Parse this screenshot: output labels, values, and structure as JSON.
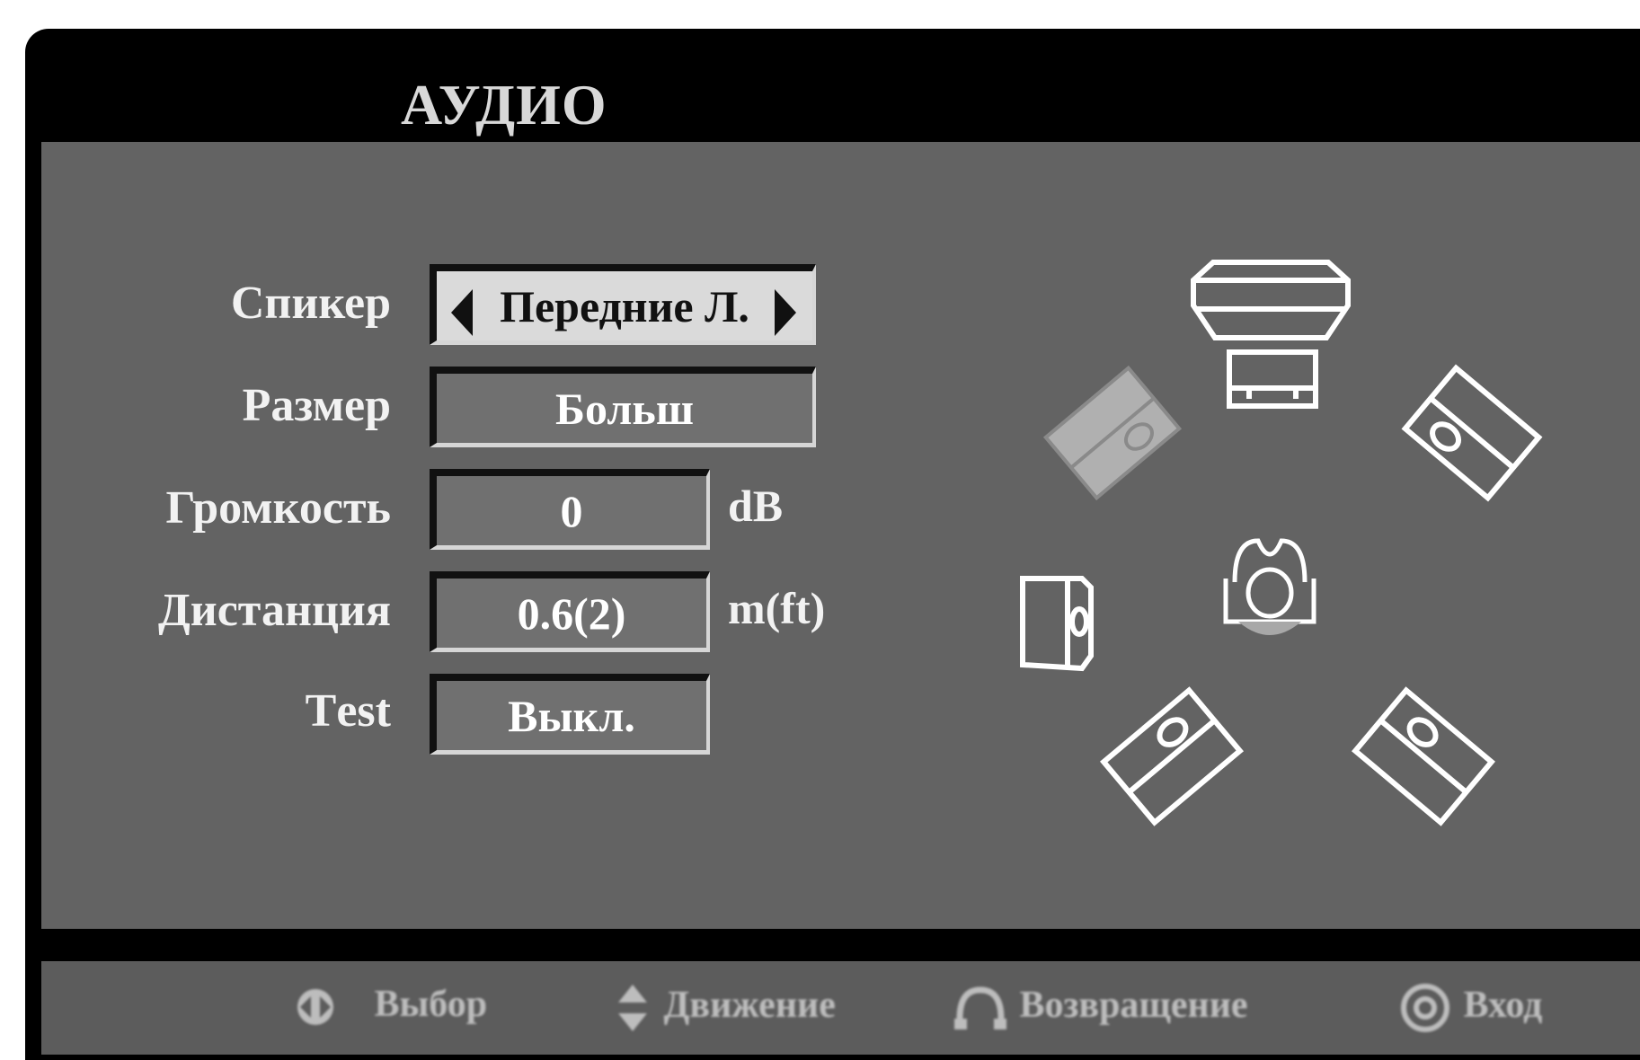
{
  "menu": {
    "title": "АУДИО"
  },
  "settings": {
    "speaker": {
      "label": "Спикер",
      "value": "Передние Л."
    },
    "size": {
      "label": "Размер",
      "value": "Больш"
    },
    "volume": {
      "label": "Громкость",
      "value": "0",
      "unit": "dB"
    },
    "distance": {
      "label": "Дистанция",
      "value": "0.6(2)",
      "unit": "m(ft)"
    },
    "test": {
      "label": "Тest",
      "value": "Выкл."
    }
  },
  "speaker_diagram": {
    "highlighted_speaker": "front-left",
    "speakers": [
      "front-left",
      "center",
      "front-right",
      "subwoofer",
      "surround-left",
      "surround-right",
      "tv"
    ],
    "icons": [
      "tv-icon",
      "center-speaker-icon",
      "front-left-speaker-icon",
      "front-right-speaker-icon",
      "subwoofer-icon",
      "listener-icon",
      "surround-left-speaker-icon",
      "surround-right-speaker-icon"
    ]
  },
  "footer": {
    "select": "Выбор",
    "move": "Движение",
    "return": "Возвращение",
    "enter": "Вход"
  },
  "colors": {
    "panel": "#636363",
    "frame": "#000000",
    "selected_field": "#dadada",
    "field": "#707070"
  }
}
